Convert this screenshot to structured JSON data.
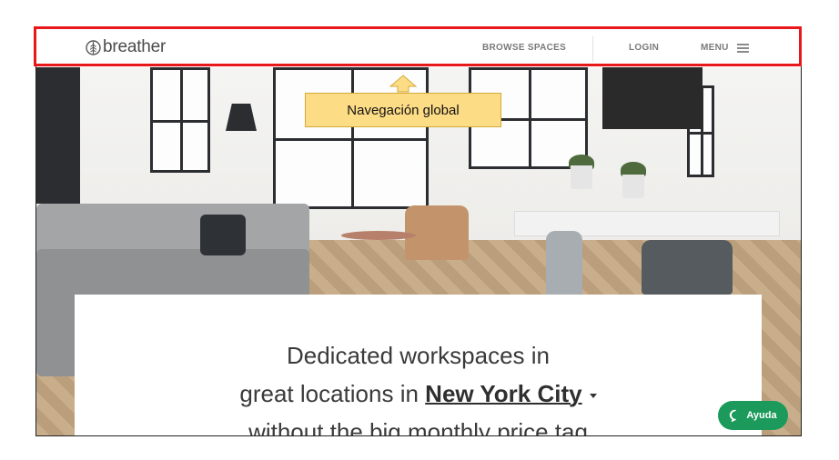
{
  "header": {
    "logo_text": "breather",
    "browse_label": "BROWSE SPACES",
    "login_label": "LOGIN",
    "menu_label": "MENU"
  },
  "hero": {
    "headline_line1": "Dedicated workspaces in",
    "headline_line2_prefix": "great locations in",
    "city": "New York City",
    "headline_line3": "without the big monthly price tag"
  },
  "help": {
    "label": "Ayuda"
  },
  "annotation": {
    "callout_text": "Navegación global"
  },
  "colors": {
    "highlight": "#e8171a",
    "callout_bg": "#fddc86",
    "help_button": "#1c9a5b"
  },
  "icons": [
    "leaf-logo-icon",
    "menu-icon",
    "dropdown-caret-icon",
    "chat-bubble-icon",
    "up-arrow-icon"
  ]
}
